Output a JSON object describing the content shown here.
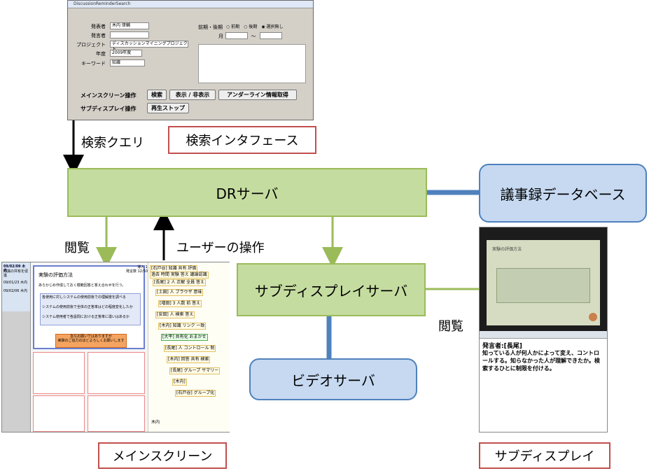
{
  "search_window": {
    "title": "DiscussionReminderSearch",
    "fields": {
      "speaker_label": "発表者",
      "speaker_value": "木内 啓輔",
      "speaker2_label": "発言者",
      "project_label": "プロジェクト",
      "project_value": "ディスカッションマイニングプロジェクト",
      "year_label": "年度",
      "year_value": "2009年度",
      "keyword_label": "キーワード",
      "keyword_value": "知識",
      "term_label": "前期・後期",
      "term_options": [
        "前期",
        "後期",
        "選択無し"
      ],
      "month_label": "月",
      "month_sep": "〜"
    },
    "main_ops_label": "メインスクリーン操作",
    "sub_ops_label": "サブディスプレイ操作",
    "buttons": {
      "search": "検索",
      "toggle": "表示 / 非表示",
      "underline": "アンダーライン情報取得",
      "stop": "再生ストップ"
    }
  },
  "labels": {
    "search_query": "検索クエリ",
    "search_interface": "検索インタフェース",
    "dr_server": "DRサーバ",
    "minutes_db": "議事録データベース",
    "browse_left": "閲覧",
    "user_ops": "ユーザーの操作",
    "subdisplay_server": "サブディスプレイサーバ",
    "browse_right": "閲覧",
    "video_server": "ビデオサーバ",
    "main_screen": "メインスクリーン",
    "sub_display": "サブディスプレイ"
  },
  "main_screen": {
    "left_items": [
      "09/02/09 木内",
      "知識の共有を促進",
      "09/01/23 木内",
      "09/02/06 木内"
    ],
    "slide_title": "実験の評価方法",
    "slide_line": "あらかじめ作成しておく模範回答と答え合わせを行う。",
    "slide_bullets": [
      "各使用に対しシステムの使用前後での理解度を調べる",
      "システムの使用前後で全体の正答率はどの程度変化したか",
      "システム使用者で各設問における正答率に違いはあるか"
    ],
    "orange_box": "急なお願いではありますが\n実験のご協力のほどよろしくお願いします",
    "header_right": "導入 1\n発言数 12/50",
    "tags": [
      "[石戸谷] 知識 共有 評価",
      "過去 時間 実験 答え 議論認識",
      "[長尾] 2 人 正解 全員 答え",
      "[土田] 人 ブラウザ 意味",
      "[増田] 3 人数 前 答え",
      "[安田] 人 検索 答え",
      "[木内] 知識 リンク 一致",
      "[大平] 共有化 おまかせ",
      "[長尾] 人 コントロール 制",
      "[木内] 回答 共有 検索",
      "[長尾] グループ サマリー",
      "[木内]",
      "[石戸谷] グループ化"
    ],
    "footer": "木内"
  },
  "sub_display": {
    "slide_title": "実験の評価方法",
    "speaker": "発言者:[長尾]",
    "utterance": "知っている人が何人かによって変え、コントロールする。知らなかった人が理解できたか。検索するひとに制限を付ける。"
  },
  "colors": {
    "server_green": "#c5dca0",
    "server_border": "#9bbb59",
    "db_blue": "#c6d9f1",
    "db_border": "#4f81bd",
    "label_red": "#c0504d",
    "arrow_green": "#9bbb59",
    "connector_blue": "#4f81bd"
  }
}
